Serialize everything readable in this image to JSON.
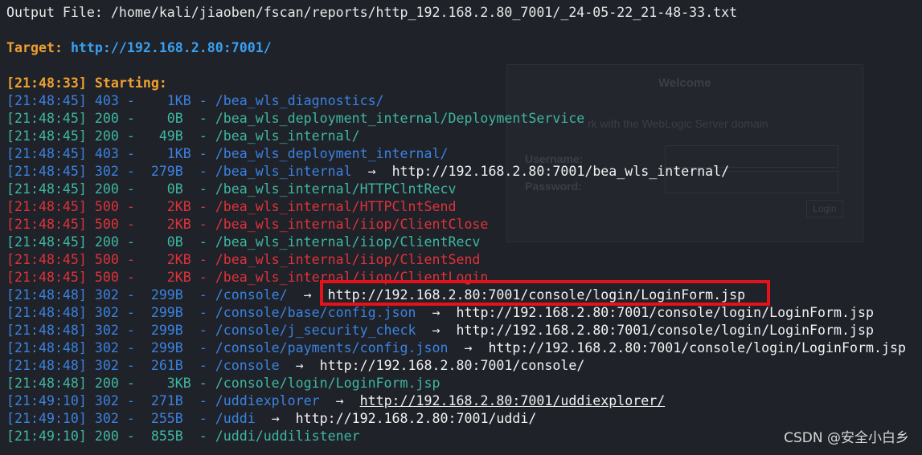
{
  "header": {
    "output_file": "Output File: /home/kali/jiaoben/fscan/reports/http_192.168.2.80_7001/_24-05-22_21-48-33.txt",
    "target_label": "Target:",
    "target_url": "http://192.168.2.80:7001/",
    "starting": "[21:48:33] Starting:"
  },
  "background_login": {
    "title": "Welcome",
    "subtitle": "rk with the WebLogic Server domain",
    "username_label": "Username:",
    "password_label": "Password:",
    "login_button": "Login"
  },
  "log": [
    {
      "text": "[21:48:45] 403 -    1KB - /bea_wls_diagnostics/",
      "redirect": "",
      "status": "403"
    },
    {
      "text": "[21:48:45] 200 -    0B  - /bea_wls_deployment_internal/DeploymentService",
      "redirect": "",
      "status": "200"
    },
    {
      "text": "[21:48:45] 200 -   49B  - /bea_wls_internal/",
      "redirect": "",
      "status": "200"
    },
    {
      "text": "[21:48:45] 403 -    1KB - /bea_wls_deployment_internal/",
      "redirect": "",
      "status": "403"
    },
    {
      "text": "[21:48:45] 302 -  279B  - /bea_wls_internal  ",
      "redirect": "http://192.168.2.80:7001/bea_wls_internal/",
      "status": "302"
    },
    {
      "text": "[21:48:45] 200 -    0B  - /bea_wls_internal/HTTPClntRecv",
      "redirect": "",
      "status": "200"
    },
    {
      "text": "[21:48:45] 500 -    2KB - /bea_wls_internal/HTTPClntSend",
      "redirect": "",
      "status": "500"
    },
    {
      "text": "[21:48:45] 500 -    2KB - /bea_wls_internal/iiop/ClientClose",
      "redirect": "",
      "status": "500"
    },
    {
      "text": "[21:48:45] 200 -    0B  - /bea_wls_internal/iiop/ClientRecv",
      "redirect": "",
      "status": "200"
    },
    {
      "text": "[21:48:45] 500 -    2KB - /bea_wls_internal/iiop/ClientSend",
      "redirect": "",
      "status": "500"
    },
    {
      "text": "[21:48:45] 500 -    2KB - /bea_wls_internal/iiop/ClientLogin",
      "redirect": "",
      "status": "500"
    },
    {
      "text": "[21:48:48] 302 -  299B  - /console/  ",
      "redirect": "http://192.168.2.80:7001/console/login/LoginForm.jsp",
      "status": "302"
    },
    {
      "text": "[21:48:48] 302 -  299B  - /console/base/config.json  ",
      "redirect": "http://192.168.2.80:7001/console/login/LoginForm.jsp",
      "status": "302"
    },
    {
      "text": "[21:48:48] 302 -  299B  - /console/j_security_check  ",
      "redirect": "http://192.168.2.80:7001/console/login/LoginForm.jsp",
      "status": "302"
    },
    {
      "text": "[21:48:48] 302 -  299B  - /console/payments/config.json  ",
      "redirect": "http://192.168.2.80:7001/console/login/LoginForm.jsp",
      "status": "302"
    },
    {
      "text": "[21:48:48] 302 -  261B  - /console  ",
      "redirect": "http://192.168.2.80:7001/console/",
      "status": "302"
    },
    {
      "text": "[21:48:48] 200 -    3KB - /console/login/LoginForm.jsp",
      "redirect": "",
      "status": "200"
    },
    {
      "text": "[21:49:10] 302 -  271B  - /uddiexplorer  ",
      "redirect": "http://192.168.2.80:7001/uddiexplorer/",
      "status": "302"
    },
    {
      "text": "[21:49:10] 302 -  255B  - /uddi  ",
      "redirect": "http://192.168.2.80:7001/uddi/",
      "status": "302"
    },
    {
      "text": "[21:49:10] 200 -  855B  - /uddi/uddilistener",
      "redirect": "",
      "status": "200"
    }
  ],
  "arrow": "→",
  "watermark": "CSDN @安全小白乡",
  "colors": {
    "background": "#1f2229",
    "status_403": "#3b82e0",
    "status_302": "#3b82e0",
    "status_200": "#3fb7a0",
    "status_500": "#e0323a",
    "target": "#f0a030",
    "highlight_border": "#e3121b"
  }
}
